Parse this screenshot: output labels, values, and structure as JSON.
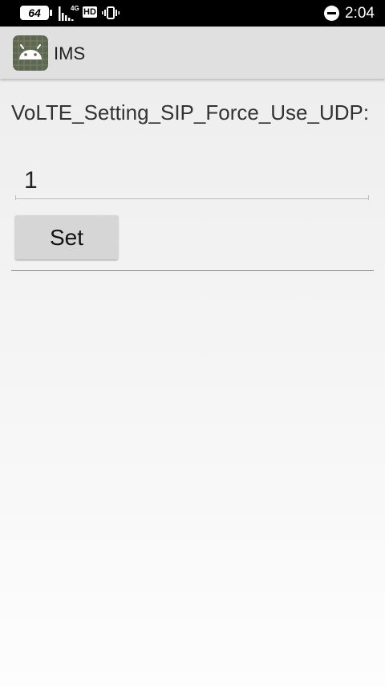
{
  "status_bar": {
    "battery_level": "64",
    "network_type": "4G",
    "hd_label": "HD",
    "time": "2:04",
    "icons": [
      "signal-icon",
      "vibrate-icon",
      "do-not-disturb-icon"
    ]
  },
  "app_bar": {
    "title": "IMS",
    "icon": "android-icon"
  },
  "setting": {
    "label": "VoLTE_Setting_SIP_Force_Use_UDP:",
    "value": "1",
    "set_label": "Set"
  },
  "colors": {
    "status_bar_bg": "#000000",
    "app_bar_bg": "#e0e0e0",
    "app_icon_bg": "#5e6750",
    "button_bg": "#d6d6d6"
  }
}
